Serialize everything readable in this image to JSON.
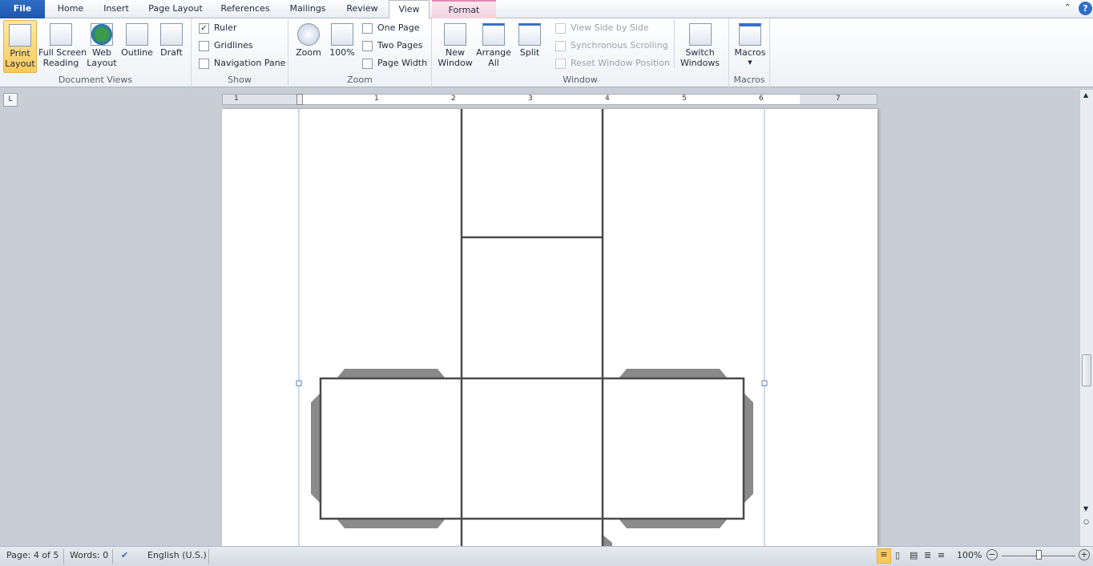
{
  "tabs": [
    "File",
    "Home",
    "Insert",
    "Page Layout",
    "References",
    "Mailings",
    "Review",
    "View",
    "Format"
  ],
  "active_tab": "View",
  "ribbon": {
    "document_views": {
      "label": "Document Views",
      "items": [
        "Print\nLayout",
        "Full Screen\nReading",
        "Web\nLayout",
        "Outline",
        "Draft"
      ],
      "selected": "Print Layout"
    },
    "show": {
      "label": "Show",
      "items": [
        {
          "label": "Ruler",
          "checked": true
        },
        {
          "label": "Gridlines",
          "checked": false
        },
        {
          "label": "Navigation Pane",
          "checked": false
        }
      ]
    },
    "zoom": {
      "label": "Zoom",
      "zoom": "Zoom",
      "hundred": "100%",
      "one_page": "One Page",
      "two_pages": "Two Pages",
      "page_width": "Page Width"
    },
    "window": {
      "label": "Window",
      "new_window": "New\nWindow",
      "arrange_all": "Arrange\nAll",
      "split": "Split",
      "view_side": "View Side by Side",
      "sync_scroll": "Synchronous Scrolling",
      "reset_pos": "Reset Window Position",
      "switch": "Switch\nWindows"
    },
    "macros": {
      "label": "Macros",
      "macros": "Macros"
    }
  },
  "ruler": {
    "numbers": [
      "1",
      "1",
      "2",
      "3",
      "4",
      "5",
      "6",
      "7"
    ]
  },
  "status": {
    "page": "Page: 4 of 5",
    "words": "Words: 0",
    "language": "English (U.S.)",
    "zoom": "100%",
    "zoom_percent": 100
  },
  "colors": {
    "accent": "#1d56ac",
    "selected": "#f9c95c",
    "shape_fill": "#8a8a8a",
    "shape_line": "#4a4a4a"
  }
}
